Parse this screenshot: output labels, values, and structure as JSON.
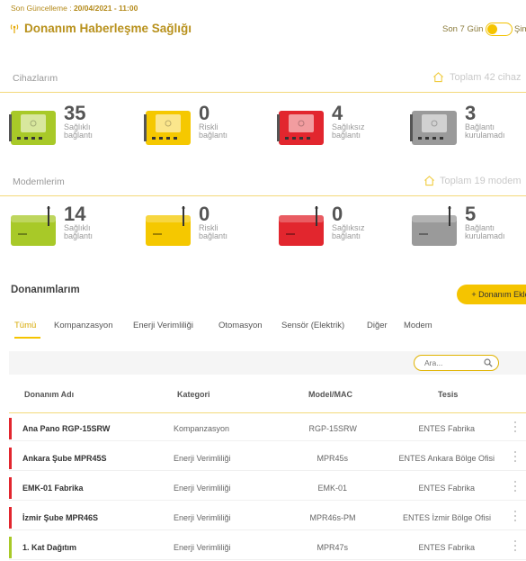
{
  "header": {
    "last_updated_label": "Son Güncelleme :",
    "last_updated_value": "20/04/2021 - 11:00",
    "title": "Donanım Haberleşme Sağlığı",
    "period_label": "Son 7 Gün",
    "now_label": "Şimdi"
  },
  "devices": {
    "label": "Cihazlarım",
    "total": "Toplam 42 cihaz",
    "stats": [
      {
        "count": "35",
        "line1": "Sağlıklı",
        "line2": "bağlantı",
        "color": "#a8c928"
      },
      {
        "count": "0",
        "line1": "Riskli",
        "line2": "bağlantı",
        "color": "#f5c800"
      },
      {
        "count": "4",
        "line1": "Sağlıksız",
        "line2": "bağlantı",
        "color": "#e2262e"
      },
      {
        "count": "3",
        "line1": "Bağlantı",
        "line2": "kurulamadı",
        "color": "#9a9a9a"
      }
    ]
  },
  "modems": {
    "label": "Modemlerim",
    "total": "Toplam 19 modem",
    "stats": [
      {
        "count": "14",
        "line1": "Sağlıklı",
        "line2": "bağlantı",
        "color": "#a8c928"
      },
      {
        "count": "0",
        "line1": "Riskli",
        "line2": "bağlantı",
        "color": "#f5c800"
      },
      {
        "count": "0",
        "line1": "Sağlıksız",
        "line2": "bağlantı",
        "color": "#e2262e"
      },
      {
        "count": "5",
        "line1": "Bağlantı",
        "line2": "kurulamadı",
        "color": "#9a9a9a"
      }
    ]
  },
  "hardware": {
    "title": "Donanımlarım",
    "add_button": "+ Donanım Ekle",
    "tabs": [
      "Tümü",
      "Kompanzasyon",
      "Enerji Verimliliği",
      "Otomasyon",
      "Sensör (Elektrik)",
      "Diğer",
      "Modem"
    ],
    "search_placeholder": "Ara...",
    "columns": [
      "Donanım Adı",
      "Kategori",
      "Model/MAC",
      "Tesis"
    ],
    "rows": [
      {
        "name": "Ana Pano RGP-15SRW",
        "category": "Kompanzasyon",
        "model": "RGP-15SRW",
        "site": "ENTES Fabrika",
        "status_color": "#e2262e"
      },
      {
        "name": "Ankara Şube MPR45S",
        "category": "Enerji Verimliliği",
        "model": "MPR45s",
        "site": "ENTES Ankara Bölge Ofisi",
        "status_color": "#e2262e"
      },
      {
        "name": "EMK-01 Fabrika",
        "category": "Enerji Verimliliği",
        "model": "EMK-01",
        "site": "ENTES Fabrika",
        "status_color": "#e2262e"
      },
      {
        "name": "İzmir Şube MPR46S",
        "category": "Enerji Verimliliği",
        "model": "MPR46s-PM",
        "site": "ENTES İzmir Bölge Ofisi",
        "status_color": "#e2262e"
      },
      {
        "name": "1. Kat Dağıtım",
        "category": "Enerji Verimliliği",
        "model": "MPR47s",
        "site": "ENTES Fabrika",
        "status_color": "#a8c928"
      }
    ]
  },
  "colors": {
    "accent": "#f5c400",
    "title": "#b8911c"
  }
}
